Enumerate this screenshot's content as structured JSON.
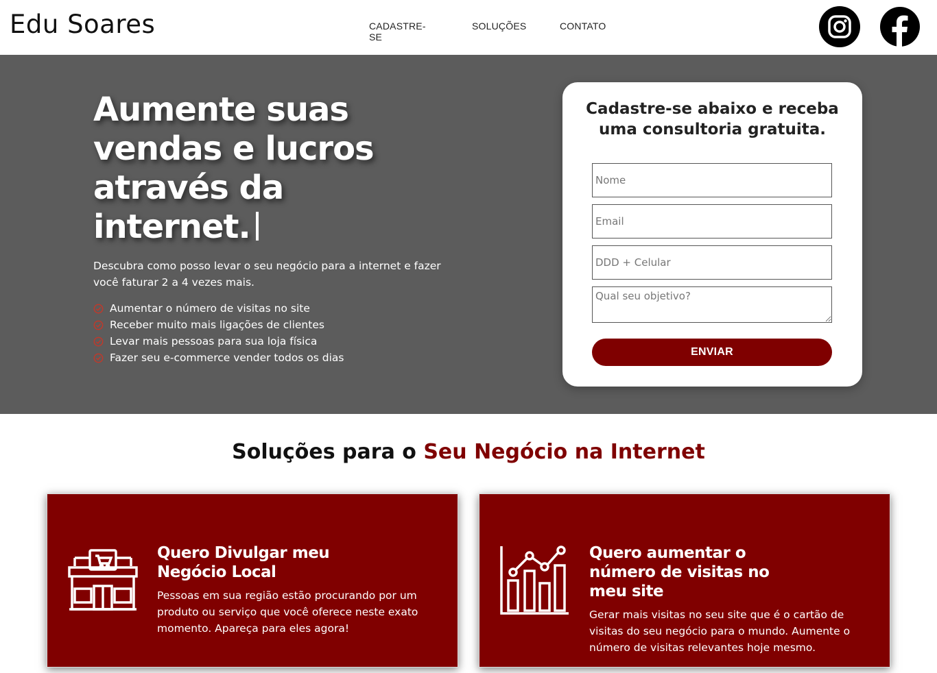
{
  "header": {
    "logo": "Edu Soares",
    "nav": [
      "CADASTRE-SE",
      "SOLUÇÕES",
      "CONTATO"
    ],
    "social": [
      "instagram-icon",
      "facebook-icon"
    ]
  },
  "hero": {
    "title": "Aumente suas vendas e lucros através da internet.",
    "subtitle": "Descubra como posso levar o seu negócio para a internet e fazer você faturar 2 a 4 vezes mais.",
    "checks": [
      "Aumentar o número de visitas no site",
      "Receber muito mais ligações de clientes",
      "Levar mais pessoas para sua loja física",
      "Fazer seu e-commerce vender todos os dias"
    ]
  },
  "form": {
    "title": "Cadastre-se abaixo e receba uma consultoria gratuita.",
    "name_placeholder": "Nome",
    "email_placeholder": "Email",
    "phone_placeholder": "DDD + Celular",
    "goal_placeholder": "Qual seu objetivo?",
    "submit_label": "ENVIAR"
  },
  "solutions": {
    "title_prefix": "Soluções para o ",
    "title_accent": "Seu Negócio na Internet",
    "cards": [
      {
        "icon": "store-icon",
        "title": "Quero Divulgar meu Negócio Local",
        "text": "Pessoas em sua região estão procurando por um produto ou serviço que você oferece neste exato momento. Apareça para eles agora!"
      },
      {
        "icon": "growth-chart-icon",
        "title": "Quero aumentar o número de visitas no meu site",
        "text": "Gerar mais visitas no seu site que é o cartão de visitas do seu negócio para o mundo. Aumente o número de visitas relevantes hoje mesmo."
      }
    ]
  },
  "colors": {
    "accent": "#7f0000",
    "hero_bg": "#5c5c5c",
    "check": "#c0392b"
  }
}
